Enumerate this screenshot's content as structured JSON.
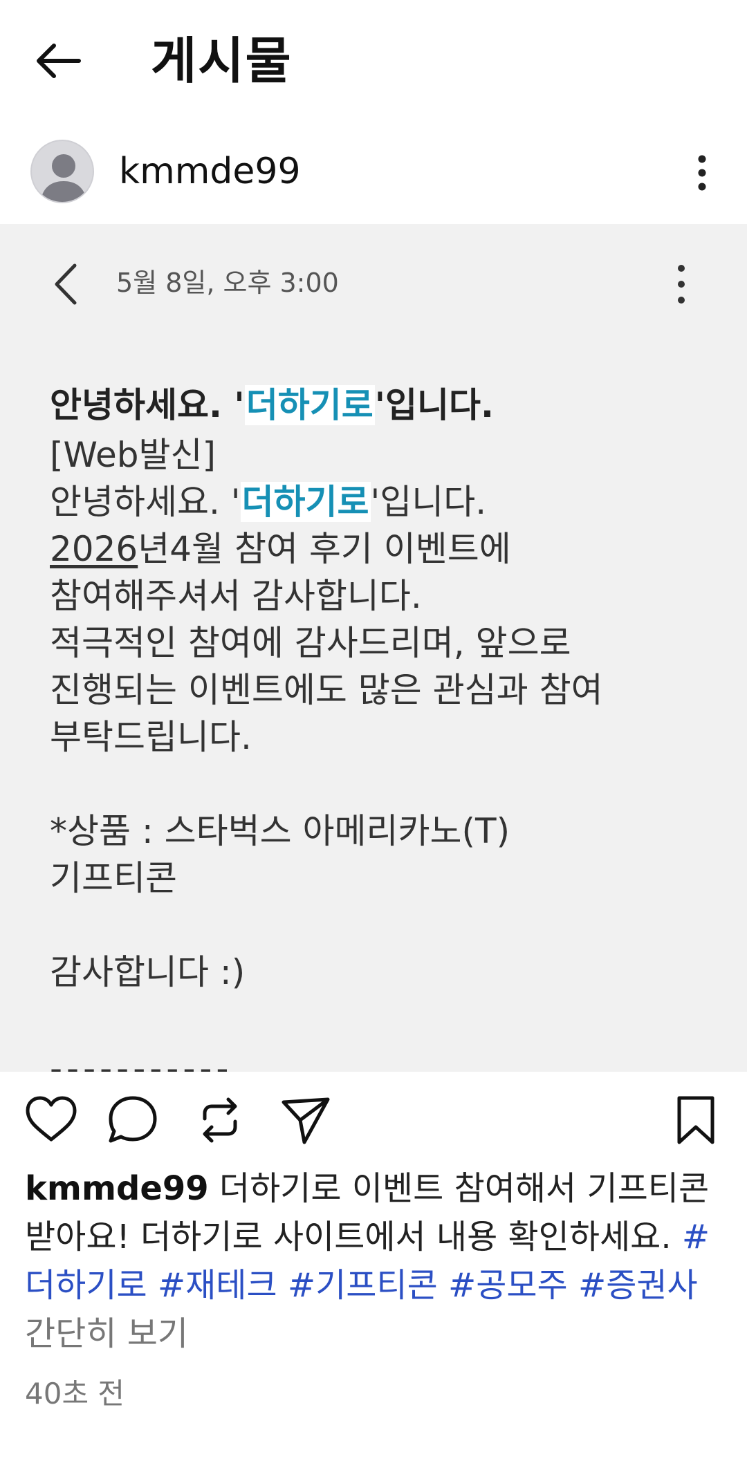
{
  "header": {
    "title": "게시물",
    "back_icon": "back-arrow-icon"
  },
  "author": {
    "username": "kmmde99",
    "avatar_icon": "default-avatar-icon",
    "more_icon": "more-vertical-icon"
  },
  "post_image": {
    "date": "5월 8일, 오후 3:00",
    "greeting_bold": {
      "before": "안녕하세요. '",
      "highlight": "더하기로",
      "after": "'입니다."
    },
    "web_tag": "[Web발신]",
    "greeting": {
      "before": "안녕하세요. '",
      "highlight": "더하기로",
      "after": "'입니다."
    },
    "line_year": {
      "underlined": "2026",
      "rest": "년4월 참여 후기 이벤트에"
    },
    "lines_1": [
      "참여해주셔서 감사합니다.",
      "적극적인 참여에 감사드리며, 앞으로",
      "진행되는 이벤트에도 많은 관심과 참여",
      "부탁드립니다."
    ],
    "prize_lines": [
      "*상품 : 스타벅스 아메리카노(T)",
      "기프티콘"
    ],
    "thanks": "감사합니다 :)",
    "dashes": "-----------"
  },
  "actions": {
    "like": "heart-icon",
    "comment": "comment-icon",
    "repost": "repost-icon",
    "share": "send-icon",
    "save": "bookmark-icon"
  },
  "caption": {
    "username": "kmmde99",
    "text": " 더하기로 이벤트 참여해서 기프티콘 받아요! 더하기로 사이트에서 내용 확인하세요. ",
    "tags": [
      "#더하기로",
      "#재테크",
      "#기프티콘",
      "#공모주",
      "#증권사"
    ],
    "more": "간단히 보기"
  },
  "timestamp": "40초 전",
  "colors": {
    "highlight": "#1690b5",
    "hashtag": "#2b4fc4",
    "image_bg": "#f1f1f1"
  }
}
